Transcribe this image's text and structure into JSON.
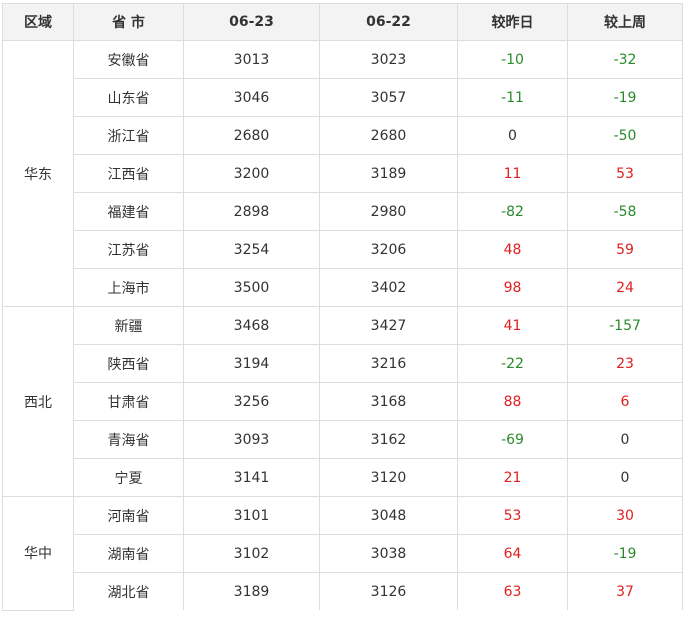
{
  "headers": [
    "区域",
    "省 市",
    "06-23",
    "06-22",
    "较昨日",
    "较上周"
  ],
  "groups": [
    {
      "region": "华东",
      "rows": [
        {
          "province": "安徽省",
          "d0623": "3013",
          "d0622": "3023",
          "vs_yesterday": "-10",
          "vs_lastweek": "-32"
        },
        {
          "province": "山东省",
          "d0623": "3046",
          "d0622": "3057",
          "vs_yesterday": "-11",
          "vs_lastweek": "-19"
        },
        {
          "province": "浙江省",
          "d0623": "2680",
          "d0622": "2680",
          "vs_yesterday": "0",
          "vs_lastweek": "-50"
        },
        {
          "province": "江西省",
          "d0623": "3200",
          "d0622": "3189",
          "vs_yesterday": "11",
          "vs_lastweek": "53"
        },
        {
          "province": "福建省",
          "d0623": "2898",
          "d0622": "2980",
          "vs_yesterday": "-82",
          "vs_lastweek": "-58"
        },
        {
          "province": "江苏省",
          "d0623": "3254",
          "d0622": "3206",
          "vs_yesterday": "48",
          "vs_lastweek": "59"
        },
        {
          "province": "上海市",
          "d0623": "3500",
          "d0622": "3402",
          "vs_yesterday": "98",
          "vs_lastweek": "24"
        }
      ]
    },
    {
      "region": "西北",
      "rows": [
        {
          "province": "新疆",
          "d0623": "3468",
          "d0622": "3427",
          "vs_yesterday": "41",
          "vs_lastweek": "-157"
        },
        {
          "province": "陕西省",
          "d0623": "3194",
          "d0622": "3216",
          "vs_yesterday": "-22",
          "vs_lastweek": "23"
        },
        {
          "province": "甘肃省",
          "d0623": "3256",
          "d0622": "3168",
          "vs_yesterday": "88",
          "vs_lastweek": "6"
        },
        {
          "province": "青海省",
          "d0623": "3093",
          "d0622": "3162",
          "vs_yesterday": "-69",
          "vs_lastweek": "0"
        },
        {
          "province": "宁夏",
          "d0623": "3141",
          "d0622": "3120",
          "vs_yesterday": "21",
          "vs_lastweek": "0"
        }
      ]
    },
    {
      "region": "华中",
      "rows": [
        {
          "province": "河南省",
          "d0623": "3101",
          "d0622": "3048",
          "vs_yesterday": "53",
          "vs_lastweek": "30"
        },
        {
          "province": "湖南省",
          "d0623": "3102",
          "d0622": "3038",
          "vs_yesterday": "64",
          "vs_lastweek": "-19"
        },
        {
          "province": "湖北省",
          "d0623": "3189",
          "d0622": "3126",
          "vs_yesterday": "63",
          "vs_lastweek": "37"
        }
      ]
    }
  ],
  "colors": {
    "up": "#e02020",
    "down": "#2b8a2b",
    "flat": "#333333",
    "header_bg": "#f3f3f3",
    "border": "#dddddd"
  }
}
